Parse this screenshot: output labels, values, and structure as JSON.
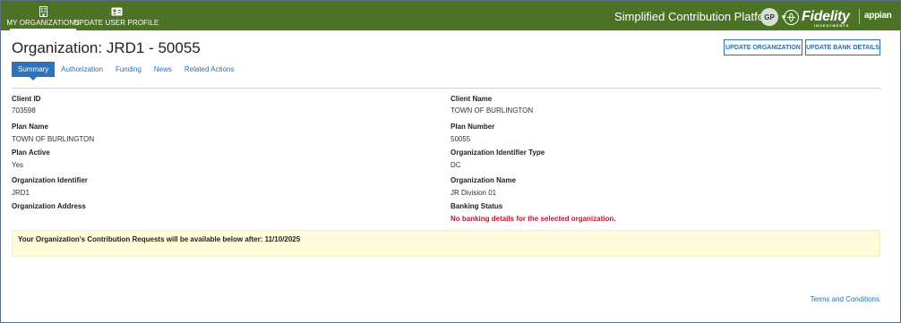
{
  "nav": {
    "my_orgs_label": "MY ORGANIZATIONS",
    "update_profile_label": "UPDATE USER PROFILE"
  },
  "header": {
    "app_title": "Simplified Contribution Platform",
    "avatar_initials": "GP",
    "brand_name": "Fidelity",
    "brand_tagline": "INVESTMENTS",
    "vendor": "appian"
  },
  "page": {
    "title": "Organization: JRD1 - 50055",
    "buttons": {
      "update_org": "UPDATE ORGANIZATION",
      "update_bank": "UPDATE BANK DETAILS"
    },
    "tabs": [
      "Summary",
      "Authorization",
      "Funding",
      "News",
      "Related Actions"
    ],
    "active_tab": "Summary"
  },
  "fields": {
    "client_id": {
      "label": "Client ID",
      "value": "703598"
    },
    "client_name": {
      "label": "Client Name",
      "value": "TOWN OF BURLINGTON"
    },
    "plan_name": {
      "label": "Plan Name",
      "value": "TOWN OF BURLINGTON"
    },
    "plan_number": {
      "label": "Plan Number",
      "value": "50055"
    },
    "plan_active": {
      "label": "Plan Active",
      "value": "Yes"
    },
    "org_id_type": {
      "label": "Organization Identifier Type",
      "value": "DC"
    },
    "org_identifier": {
      "label": "Organization Identifier",
      "value": "JRD1"
    },
    "org_name": {
      "label": "Organization Name",
      "value": "JR Division 01"
    },
    "org_address": {
      "label": "Organization Address",
      "value": ""
    },
    "banking_status": {
      "label": "Banking Status",
      "value": "No banking details for the selected organization."
    }
  },
  "banner": {
    "text": "Your Organization's Contribution Requests will be available below after: 11/10/2025"
  },
  "footer": {
    "terms_label": "Terms and Conditions"
  },
  "colors": {
    "topbar": "#4c7226",
    "link": "#2a6fb3",
    "active_tab": "#2f73b6",
    "error": "#c8102e",
    "banner_bg": "#fdfbd9"
  }
}
